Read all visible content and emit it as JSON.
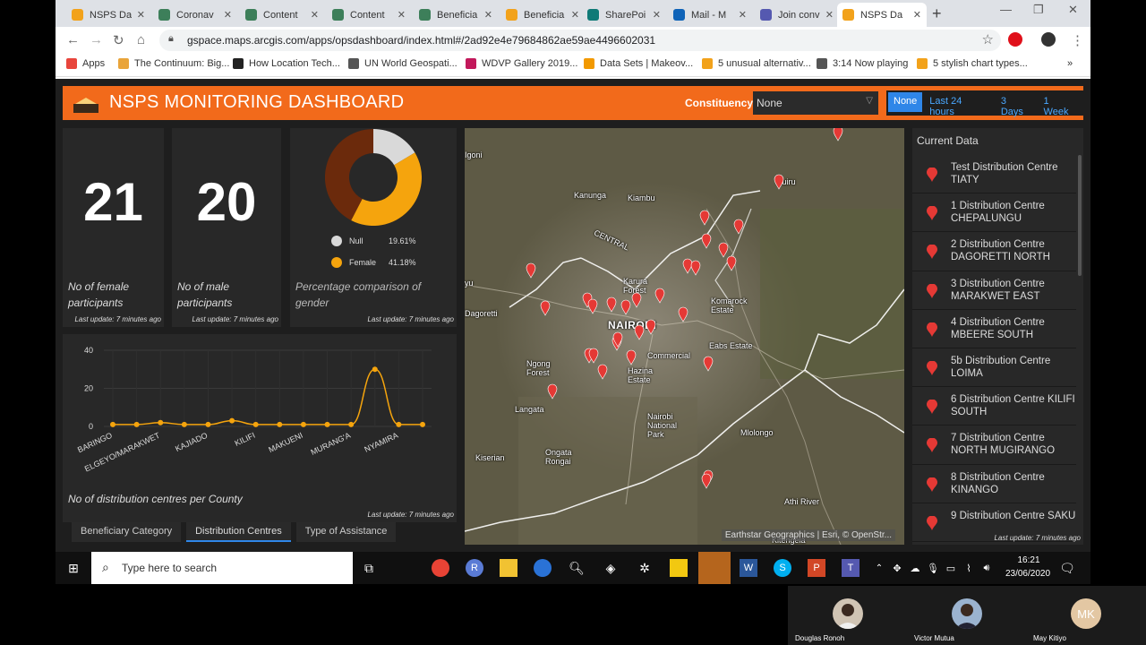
{
  "browser": {
    "tabs": [
      {
        "title": "NSPS Da",
        "icon": "dashboard-icon",
        "color": "#f2a21b"
      },
      {
        "title": "Coronav",
        "icon": "globe-icon",
        "color": "#3d7f5a"
      },
      {
        "title": "Content",
        "icon": "globe-icon",
        "color": "#3d7f5a"
      },
      {
        "title": "Content",
        "icon": "globe-icon",
        "color": "#3d7f5a"
      },
      {
        "title": "Beneficia",
        "icon": "globe-icon",
        "color": "#3d7f5a"
      },
      {
        "title": "Beneficia",
        "icon": "dashboard-icon",
        "color": "#f2a21b"
      },
      {
        "title": "SharePoi",
        "icon": "sharepoint-icon",
        "color": "#0f7a77"
      },
      {
        "title": "Mail - M",
        "icon": "outlook-icon",
        "color": "#0f63b8"
      },
      {
        "title": "Join conv",
        "icon": "teams-icon",
        "color": "#5559b0"
      },
      {
        "title": "NSPS Da",
        "icon": "dashboard-icon",
        "color": "#f2a21b"
      }
    ],
    "url": "gspace.maps.arcgis.com/apps/opsdashboard/index.html#/2ad92e4e79684862ae59ae4496602031",
    "bookmarks": [
      {
        "label": "Apps",
        "icon": "apps-grid-icon"
      },
      {
        "label": "The Continuum: Big...",
        "icon": "bookmark-icon"
      },
      {
        "label": "How Location Tech...",
        "icon": "f-logo-icon"
      },
      {
        "label": "UN World Geospati...",
        "icon": "globe-icon"
      },
      {
        "label": "WDVP Gallery 2019...",
        "icon": "star-burst-icon"
      },
      {
        "label": "Data Sets | Makeov...",
        "icon": "upload-icon"
      },
      {
        "label": "5 unusual alternativ...",
        "icon": "dots-icon"
      },
      {
        "label": "3:14 Now playing",
        "icon": "globe-icon"
      },
      {
        "label": "5 stylish chart types...",
        "icon": "dots-icon"
      }
    ],
    "bookmarks_more": "»"
  },
  "dashboard": {
    "title": "NSPS MONITORING DASHBOARD",
    "constituency_label": "Constituency",
    "constituency_value": "None",
    "time_filters": [
      "None",
      "Last 24 hours",
      "3 Days",
      "1 Week"
    ],
    "female": {
      "value": "21",
      "desc": "No of female participants",
      "update": "Last update: 7 minutes ago"
    },
    "male": {
      "value": "20",
      "desc": "No of male participants",
      "update": "Last update: 7 minutes ago"
    },
    "gender": {
      "desc": "Percentage comparison of gender",
      "update": "Last update: 7 minutes ago",
      "legend": [
        {
          "label": "Null",
          "pct": "19.61%",
          "color": "#d9d9d9"
        },
        {
          "label": "Female",
          "pct": "41.18%",
          "color": "#f5a40d"
        }
      ]
    },
    "county_chart": {
      "desc": "No of distribution centres per County",
      "update": "Last update: 7 minutes ago"
    },
    "bottom_tabs": [
      "Beneficiary Category",
      "Distribution Centres",
      "Type of Assistance"
    ],
    "map": {
      "labels": [
        "Igoni",
        "Kanunga",
        "Kiambu",
        "Ruiru",
        "CENTRAL",
        "Karura Forest",
        "Komarock Estate",
        "Dagoretti",
        "NAIROBI",
        "Eabs Estate",
        "Commercial",
        "Ngong Forest",
        "Hazina Estate",
        "NAIROBI",
        "Langata",
        "Nairobi National Park",
        "Mlolongo",
        "Kiserian",
        "Ongata Rongai",
        "Athi River",
        "Kitengela",
        "yu"
      ],
      "attribution": "Earthstar Geographics | Esri, © OpenStr..."
    },
    "current_data": {
      "title": "Current Data",
      "update": "Last update: 7 minutes ago",
      "items": [
        "Test Distribution Centre TIATY",
        "1 Distribution Centre CHEPALUNGU",
        "2 Distribution Centre DAGORETTI NORTH",
        "3 Distribution Centre MARAKWET EAST",
        "4 Distribution Centre MBEERE SOUTH",
        "5b Distribution Centre LOIMA",
        "6 Distribution Centre KILIFI SOUTH",
        "7 Distribution Centre NORTH MUGIRANGO",
        "8 Distribution Centre KINANGO",
        "9 Distribution Centre SAKU"
      ]
    }
  },
  "chart_data": {
    "type": "line",
    "categories": [
      "BARINGO",
      "",
      "ELGEYO/MARAKWET",
      "",
      "KAJIADO",
      "",
      "KILIFI",
      "",
      "MAKUENI",
      "",
      "MURANG'A",
      "",
      "NYAMIRA",
      ""
    ],
    "values": [
      1,
      1,
      2,
      1,
      1,
      3,
      1,
      1,
      1,
      1,
      1,
      30,
      1,
      1
    ],
    "yticks": [
      0,
      20,
      40
    ],
    "ylim": [
      0,
      40
    ],
    "color": "#f5a40d",
    "grid": true
  },
  "taskbar": {
    "search_placeholder": "Type here to search",
    "time": "16:21",
    "date": "23/06/2020"
  },
  "participants": [
    {
      "name": "Douglas Ronoh"
    },
    {
      "name": "Victor Mutua"
    },
    {
      "name": "May Kitiyo",
      "initials": "MK"
    }
  ]
}
